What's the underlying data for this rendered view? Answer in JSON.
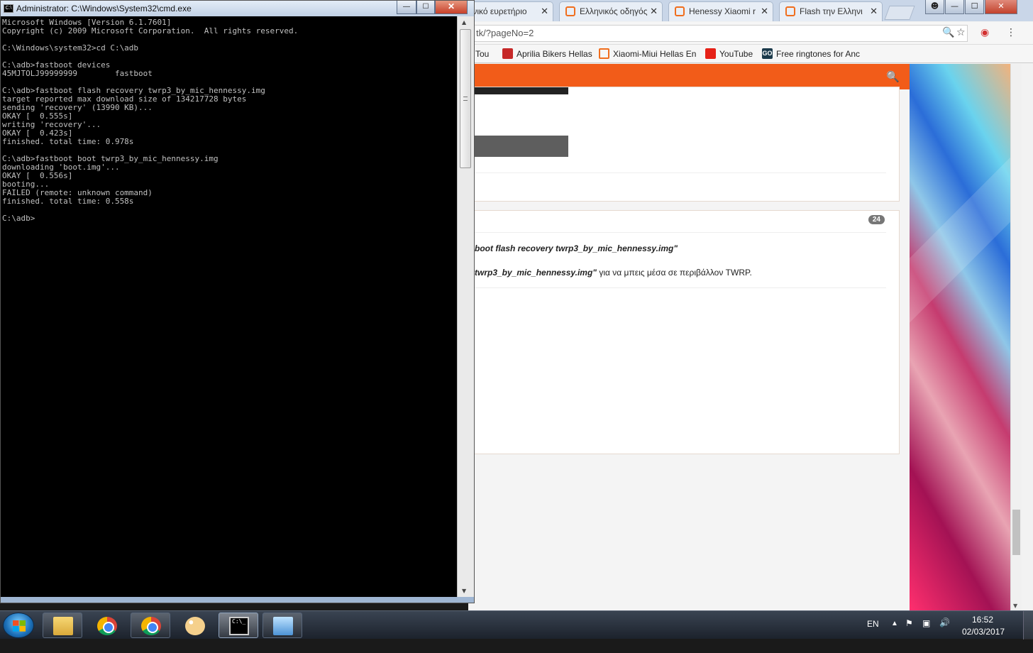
{
  "cmd": {
    "title": "Administrator: C:\\Windows\\System32\\cmd.exe",
    "icon_text": "C:\\",
    "buttons": {
      "minimize": "—",
      "maximize": "☐",
      "close": "✕"
    },
    "lines": [
      "Microsoft Windows [Version 6.1.7601]",
      "Copyright (c) 2009 Microsoft Corporation.  All rights reserved.",
      "",
      "C:\\Windows\\system32>cd C:\\adb",
      "",
      "C:\\adb>fastboot devices",
      "45MJTOLJ99999999        fastboot",
      "",
      "C:\\adb>fastboot flash recovery twrp3_by_mic_hennessy.img",
      "target reported max download size of 134217728 bytes",
      "sending 'recovery' (13990 KB)...",
      "OKAY [  0.555s]",
      "writing 'recovery'...",
      "OKAY [  0.423s]",
      "finished. total time: 0.978s",
      "",
      "C:\\adb>fastboot boot twrp3_by_mic_hennessy.img",
      "downloading 'boot.img'...",
      "OKAY [  0.556s]",
      "booting...",
      "FAILED (remote: unknown command)",
      "finished. total time: 0.558s",
      "",
      "C:\\adb>"
    ]
  },
  "browser": {
    "tabs": [
      {
        "label": "ενικό ευρετήριο"
      },
      {
        "label": "Ελληνικός οδηγός"
      },
      {
        "label": "Henessy Xiaomi r"
      },
      {
        "label": "Flash την Ελληνι"
      }
    ],
    "tab_close": "✕",
    "url": "tk/?pageNo=2",
    "bookmarks": [
      {
        "label": "Tou",
        "color": "#ffffff"
      },
      {
        "label": "Aprilia Bikers Hellas",
        "color": "#c62828"
      },
      {
        "label": "Xiaomi-Miui Hellas En",
        "color": "#f06e1e"
      },
      {
        "label": "YouTube",
        "color": "#e62117"
      },
      {
        "label": "Free ringtones for Anc",
        "color": "#1b3a4b"
      }
    ],
    "bookmark_go": "GO",
    "accent": "#f25c19",
    "post": {
      "badge": "24",
      "line1": "boot flash recovery twrp3_by_mic_hennessy.img\"",
      "line2_em": "twrp3_by_mic_hennessy.img\"",
      "line2_rest": " για να μπεις μέσα σε περιβάλλον TWRP."
    }
  },
  "taskbar": {
    "language": "EN",
    "time": "16:52",
    "date": "02/03/2017",
    "cmd_glyph": "C:\\_"
  }
}
